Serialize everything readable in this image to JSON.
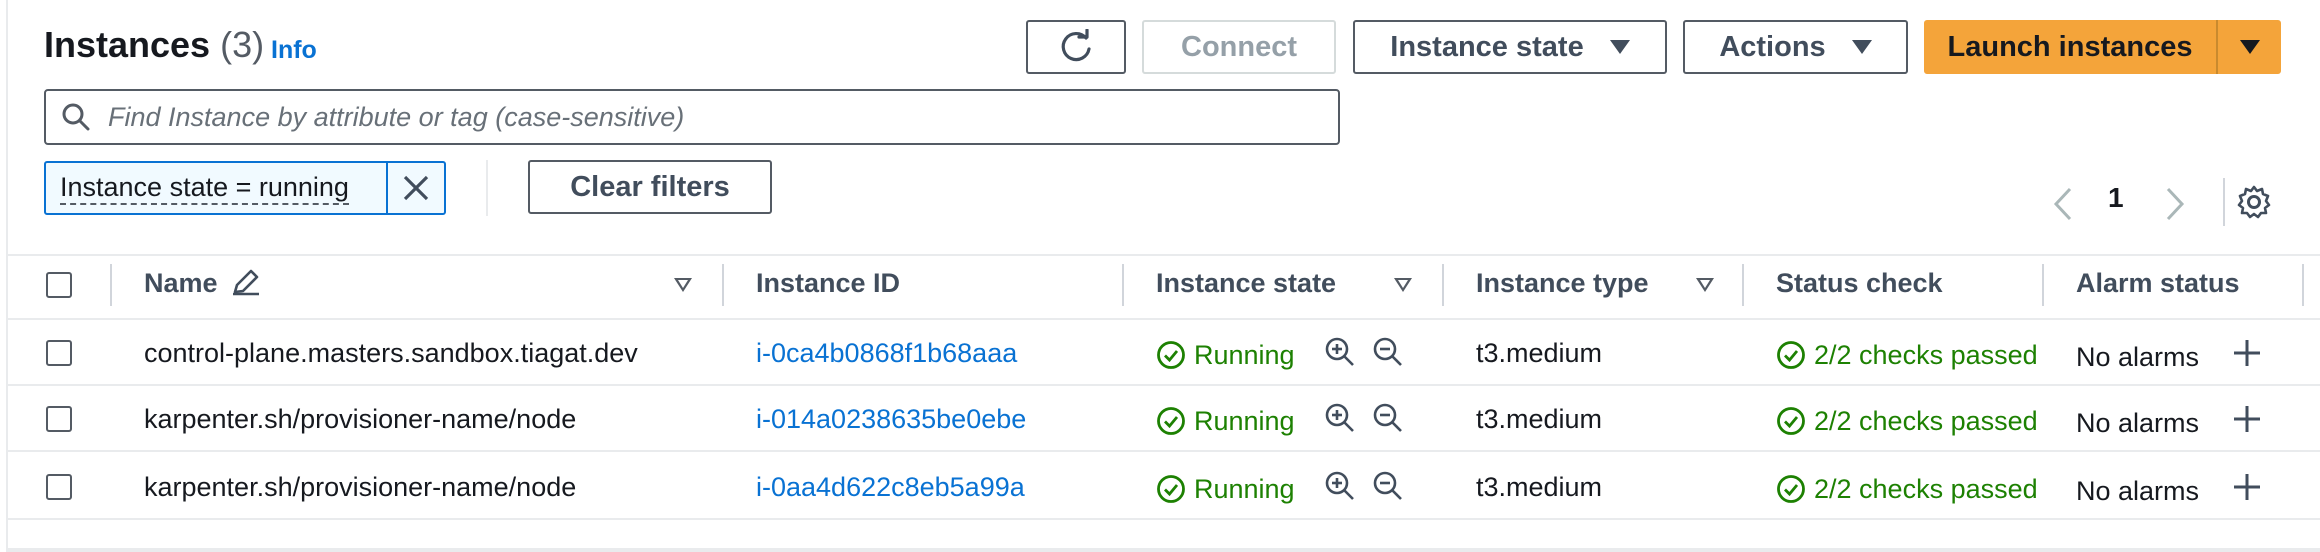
{
  "header": {
    "title": "Instances",
    "count": "(3)",
    "info": "Info"
  },
  "toolbar": {
    "refresh_icon": "refresh-icon",
    "connect": "Connect",
    "instance_state": "Instance state",
    "actions": "Actions",
    "launch": "Launch instances"
  },
  "search": {
    "placeholder": "Find Instance by attribute or tag (case-sensitive)",
    "value": ""
  },
  "filter": {
    "token": "Instance state = running",
    "clear": "Clear filters"
  },
  "pagination": {
    "page": "1"
  },
  "table": {
    "columns": {
      "name": "Name",
      "instance_id": "Instance ID",
      "instance_state": "Instance state",
      "instance_type": "Instance type",
      "status_check": "Status check",
      "alarm_status": "Alarm status"
    },
    "rows": [
      {
        "name": "control-plane.masters.sandbox.tiagat.dev",
        "instance_id": "i-0ca4b0868f1b68aaa",
        "state": "Running",
        "type": "t3.medium",
        "status": "2/2 checks passed",
        "alarm": "No alarms"
      },
      {
        "name": "karpenter.sh/provisioner-name/node",
        "instance_id": "i-014a0238635be0ebe",
        "state": "Running",
        "type": "t3.medium",
        "status": "2/2 checks passed",
        "alarm": "No alarms"
      },
      {
        "name": "karpenter.sh/provisioner-name/node",
        "instance_id": "i-0aa4d622c8eb5a99a",
        "state": "Running",
        "type": "t3.medium",
        "status": "2/2 checks passed",
        "alarm": "No alarms"
      }
    ]
  },
  "colors": {
    "accent": "#0972d3",
    "primary_button": "#f4a43a",
    "success": "#1d8102"
  }
}
